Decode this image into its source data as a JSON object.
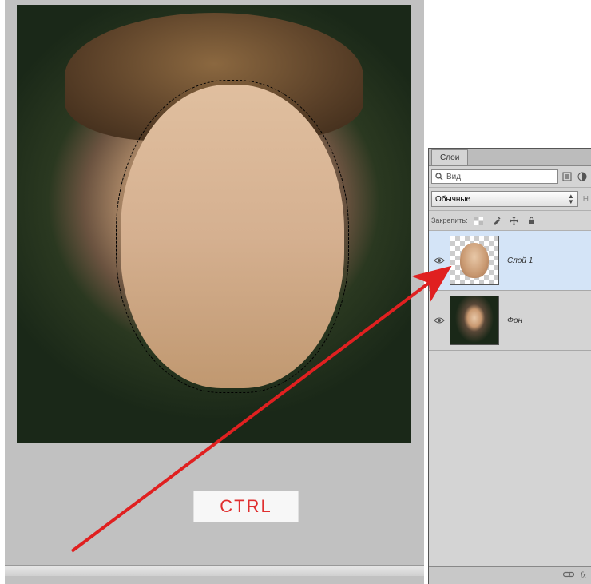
{
  "annotation": {
    "ctrl_label": "CTRL"
  },
  "panel": {
    "tab_label": "Слои",
    "search_placeholder": "Вид",
    "blend_mode": "Обычные",
    "right_label_partial": "Н",
    "lock_label": "Закрепить:",
    "layers": [
      {
        "name": "Слой 1",
        "selected": true
      },
      {
        "name": "Фон",
        "selected": false
      }
    ],
    "footer": {
      "link_icon": "link-icon",
      "fx_label": "fx"
    }
  }
}
